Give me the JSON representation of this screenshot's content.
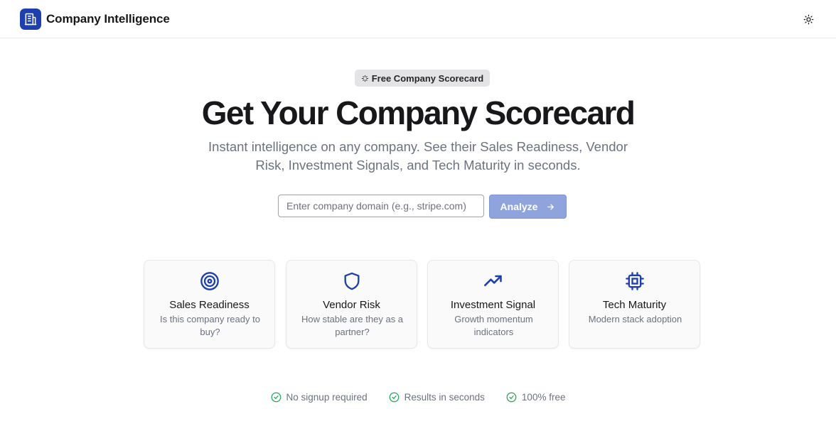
{
  "header": {
    "title": "Company Intelligence",
    "logo_icon": "building-icon",
    "theme_icon": "sun-icon"
  },
  "hero": {
    "badge": "Free Company Scorecard",
    "badge_icon": "sparkle-icon",
    "title": "Get Your Company Scorecard",
    "subtitle": "Instant intelligence on any company. See their Sales Readiness, Vendor Risk, Investment Signals, and Tech Maturity in seconds."
  },
  "search": {
    "placeholder": "Enter company domain (e.g., stripe.com)",
    "value": "",
    "button_label": "Analyze",
    "button_icon": "arrow-right-icon"
  },
  "cards": [
    {
      "icon": "target-icon",
      "title": "Sales Readiness",
      "description": "Is this company ready to buy?"
    },
    {
      "icon": "shield-icon",
      "title": "Vendor Risk",
      "description": "How stable are they as a partner?"
    },
    {
      "icon": "trending-up-icon",
      "title": "Investment Signal",
      "description": "Growth momentum indicators"
    },
    {
      "icon": "cpu-icon",
      "title": "Tech Maturity",
      "description": "Modern stack adoption"
    }
  ],
  "features": [
    {
      "icon": "check-circle-icon",
      "label": "No signup required"
    },
    {
      "icon": "check-circle-icon",
      "label": "Results in seconds"
    },
    {
      "icon": "check-circle-icon",
      "label": "100% free"
    }
  ],
  "colors": {
    "brand": "#1e40af",
    "button": "#8fa3dc",
    "check": "#22a55b"
  }
}
